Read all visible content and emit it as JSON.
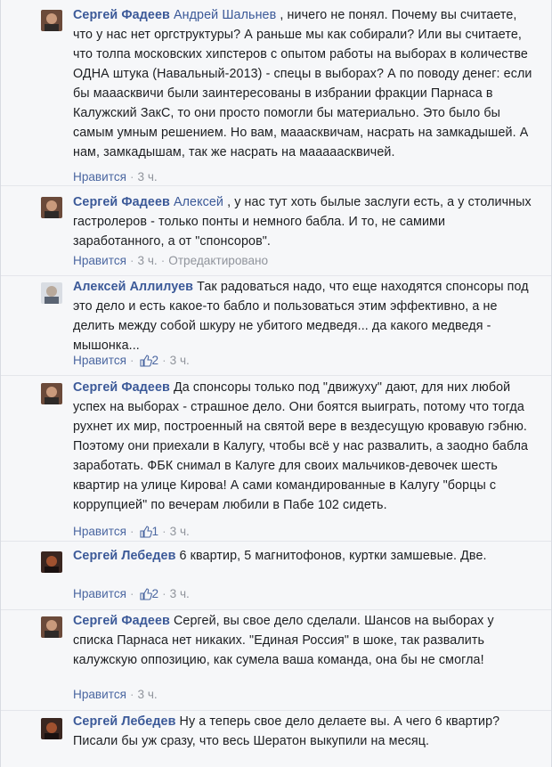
{
  "comments": [
    {
      "author": "Сергей Фадеев",
      "mention": "Андрей Шальнев",
      "text": ", ничего не понял. Почему вы считаете, что у нас нет оргструктуры? А раньше мы как собирали? Или вы считаете, что толпа московских хипстеров с опытом работы на выборах в количестве ОДНА штука (Навальный-2013) - спецы в выборах? А по поводу денег: если бы мааасквичи были заинтересованы в избрании фракции Парнаса в Калужский ЗакС, то они просто помогли бы материально. Это было бы самым умным решением. Но вам, мааасквичам, насрать на замкадышей. А нам, замкадышам, так же насрать на мааааасквичей.",
      "like": "Нравится",
      "time": "3 ч.",
      "avatar_icon": "user-avatar-icon"
    },
    {
      "author": "Сергей Фадеев",
      "mention": "Алексей",
      "text": ", у нас тут хоть былые заслуги есть, а у столичных гастролеров - только понты и немного бабла. И то, не самими заработанного, а от \"спонсоров\".",
      "like": "Нравится",
      "time": "3 ч.",
      "edited": "Отредактировано",
      "avatar_icon": "user-avatar-icon"
    },
    {
      "author": "Алексей Аллилуев",
      "mention": "",
      "text": "Так радоваться надо, что еще находятся спонсоры под это дело и есть какое-то бабло и пользоваться этим эффективно, а не делить между собой шкуру не убитого медведя... да какого медведя - мышонка...",
      "like": "Нравится",
      "likes": "2",
      "time": "3 ч.",
      "avatar_icon": "user-avatar-icon"
    },
    {
      "author": "Сергей Фадеев",
      "mention": "",
      "text": "Да спонсоры только под \"движуху\" дают, для них любой успех на выборах - страшное дело. Они боятся выиграть, потому что тогда рухнет их мир, построенный на святой вере в вездесущую кровавую гэбню. Поэтому они приехали в Калугу, чтобы всё у нас развалить, а заодно бабла заработать. ФБК снимал в Калуге для своих мальчиков-девочек шесть квартир на улице Кирова! А сами командированные в Калугу \"борцы с коррупцией\" по вечерам любили в Пабе 102 сидеть.",
      "like": "Нравится",
      "likes": "1",
      "time": "3 ч.",
      "avatar_icon": "user-avatar-icon"
    },
    {
      "author": "Сергей Лебедев",
      "mention": "",
      "text": "6 квартир, 5 магнитофонов, куртки замшевые. Две.",
      "like": "Нравится",
      "likes": "2",
      "time": "3 ч.",
      "avatar_icon": "user-avatar-icon"
    },
    {
      "author": "Сергей Фадеев",
      "mention": "",
      "text": "Сергей, вы свое дело сделали. Шансов на выборах у списка Парнаса нет никаких. \"Единая Россия\" в шоке, так развалить калужскую оппозицию, как сумела ваша команда, она бы не смогла!",
      "like": "Нравится",
      "time": "3 ч.",
      "avatar_icon": "user-avatar-icon"
    },
    {
      "author": "Сергей Лебедев",
      "mention": "",
      "text": "Ну а теперь свое дело делаете вы. А чего 6 квартир? Писали бы уж сразу, что весь Шератон выкупили на месяц.",
      "avatar_icon": "user-avatar-icon"
    }
  ],
  "colors": {
    "author": "#3b5998",
    "meta": "#90949c",
    "background": "#f6f7f9"
  },
  "thumb_icon": "thumbs-up-icon"
}
